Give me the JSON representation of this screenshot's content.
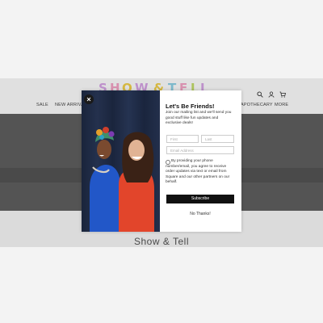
{
  "store": {
    "logo_text": "SHOW & TELL",
    "footer_title": "Show & Tell"
  },
  "nav": {
    "items": [
      "SALE",
      "NEW ARRIVALS",
      "APOTHECARY",
      "MORE"
    ]
  },
  "header": {
    "icons": [
      "search-icon",
      "account-icon",
      "cart-icon"
    ]
  },
  "modal": {
    "title": "Let's Be Friends!",
    "description": "Join our mailing list and we'll send you good stuff like fun updates and exclusive deals!",
    "first_placeholder": "First",
    "last_placeholder": "Last",
    "email_placeholder": "Email Address",
    "consent_text": "By providing your phone number/email, you agree to receive order updates via text or email from Square and our other partners on our behalf.",
    "subscribe_label": "Subscribe",
    "no_thanks_label": "No Thanks!",
    "close_icon": "close-icon"
  },
  "colors": {
    "logo_palette": [
      "#d9a5e8",
      "#f6a6c8",
      "#f3d24b",
      "#8fd3e8",
      "#c5e06a"
    ],
    "button": "#111111"
  }
}
